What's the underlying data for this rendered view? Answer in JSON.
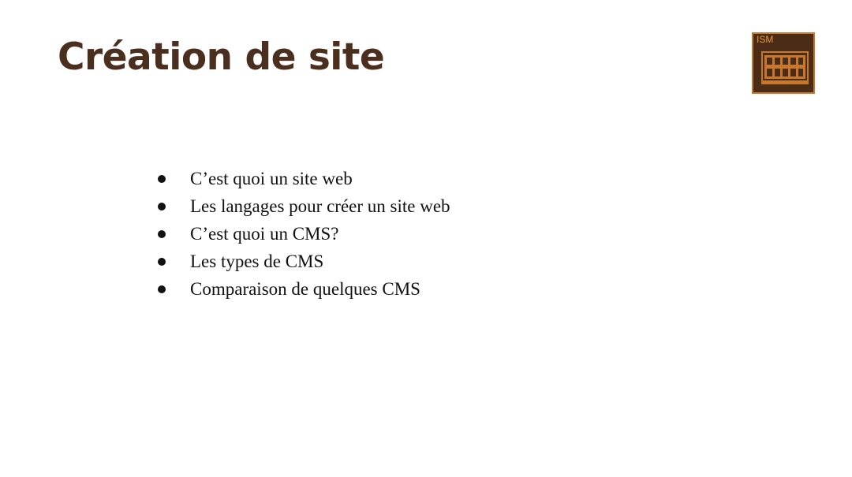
{
  "slide": {
    "title": "Création de site",
    "logo": {
      "text": "ISM",
      "icon": "building-icon",
      "colors": {
        "background": "#4b2c17",
        "border": "#c8782c",
        "text": "#e39a48"
      }
    },
    "bullets": [
      "C’est quoi un site web",
      "Les langages pour créer un site web",
      "C’est quoi un CMS?",
      "Les types de CMS",
      "Comparaison de quelques CMS"
    ],
    "colors": {
      "title": "#4a2e1e",
      "body_text": "#111111",
      "background": "#ffffff"
    }
  }
}
